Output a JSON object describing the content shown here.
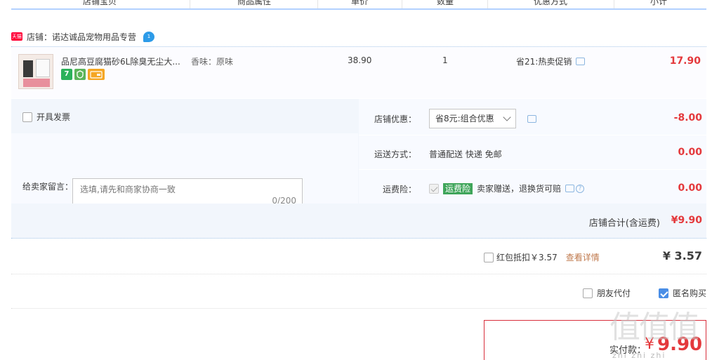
{
  "header": {
    "cols": [
      "店铺宝贝",
      "商品属性",
      "单价",
      "数量",
      "优惠方式",
      "小计"
    ]
  },
  "shop": {
    "badge": "天猫",
    "label": "店铺：诺达诚品宠物用品专营",
    "chat_badge": "1"
  },
  "item": {
    "title": "品尼高豆腐猫砂6L除臭无尘大...",
    "tag_seven": "7",
    "attr": "香味：原味",
    "price": "38.90",
    "qty": "1",
    "promo": "省21:热卖促销",
    "subtotal": "17.90"
  },
  "invoice": {
    "label": "开具发票"
  },
  "message": {
    "label": "给卖家留言：",
    "placeholder": "选填,请先和商家协商一致",
    "count": "0/200"
  },
  "discount": {
    "label": "店铺优惠：",
    "selected": "省8元:组合优惠",
    "value": "-8.00"
  },
  "shipping": {
    "label": "运送方式：",
    "method": "普通配送 快递 免邮",
    "value": "0.00"
  },
  "insurance": {
    "label": "运费险：",
    "tag": "运费险",
    "desc": "卖家赠送，退换货可赔",
    "value": "0.00"
  },
  "shop_total": {
    "label": "店铺合计(含运费)",
    "value": "¥9.90"
  },
  "redpack": {
    "label": "红包抵扣￥3.57",
    "link": "查看详情",
    "amount": "¥ 3.57"
  },
  "options": {
    "friend_pay": "朋友代付",
    "anonymous": "匿名购买"
  },
  "pay": {
    "label": "实付款：",
    "symbol": "¥",
    "amount": "9.90"
  },
  "watermark": {
    "text": "值值值",
    "url": "zhi zhi zhi"
  },
  "colors": {
    "price_red": "#e4393c",
    "header_line": "#b2d1ff",
    "panel_bg": "#f2f6fc"
  }
}
